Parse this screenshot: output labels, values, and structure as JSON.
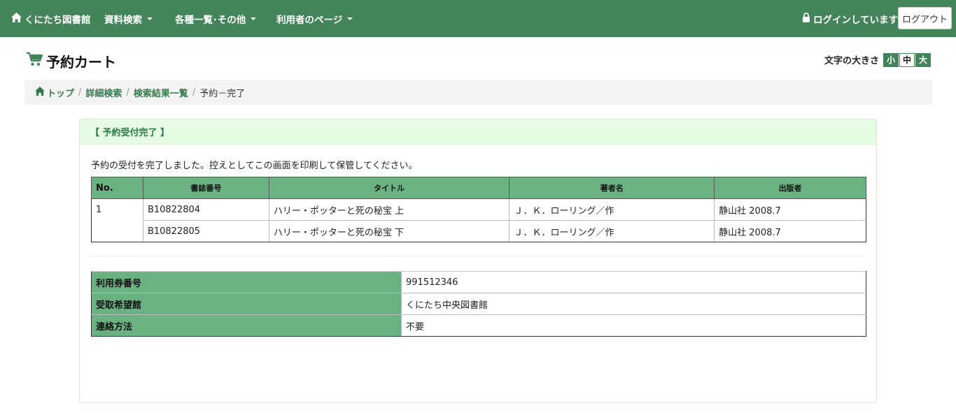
{
  "nav": {
    "brand": "くにたち図書館",
    "search": "資料検索",
    "lists": "各種一覧･その他",
    "user_page": "利用者のページ",
    "login_status": "ログインしています",
    "logout": "ログアウト"
  },
  "page": {
    "title": "予約カート"
  },
  "font_size": {
    "label": "文字の大きさ",
    "small": "小",
    "medium": "中",
    "large": "大"
  },
  "breadcrumb": {
    "top": "トップ",
    "detail_search": "詳細検索",
    "results": "検索結果一覧",
    "current": "予約－完了"
  },
  "panel": {
    "heading": "【  予約受付完了  】",
    "message": "予約の受付を完了しました。控えとしてこの画面を印刷して保管してください。"
  },
  "books_table": {
    "headers": [
      "No.",
      "書誌番号",
      "タイトル",
      "著者名",
      "出版者"
    ],
    "no": "1",
    "rows": [
      {
        "id": "B10822804",
        "title": "ハリー・ポッターと死の秘宝 上",
        "author": "Ｊ．Ｋ．ローリング／作",
        "publisher": "静山社 2008.7"
      },
      {
        "id": "B10822805",
        "title": "ハリー・ポッターと死の秘宝 下",
        "author": "Ｊ．Ｋ．ローリング／作",
        "publisher": "静山社 2008.7"
      }
    ]
  },
  "info_table": {
    "card_label": "利用券番号",
    "card_value": "991512346",
    "library_label": "受取希望館",
    "library_value": "くにたち中央図書館",
    "contact_label": "連絡方法",
    "contact_value": "不要"
  },
  "colors": {
    "nav_bg": "#44845b",
    "table_header_bg": "#6bb283",
    "panel_head_bg": "#e5fce3"
  }
}
